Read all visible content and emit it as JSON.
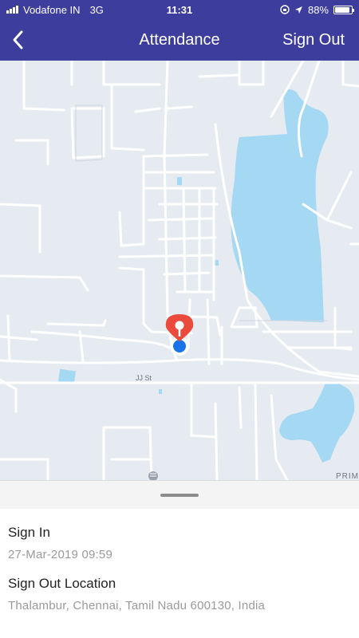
{
  "status_bar": {
    "carrier": "Vodafone IN",
    "network": "3G",
    "time": "11:31",
    "battery_percent": "88%",
    "battery_level": 0.88,
    "icons": [
      "signal-bars-icon",
      "lock-rotation-icon",
      "location-arrow-icon",
      "battery-icon"
    ]
  },
  "nav": {
    "back_icon": "chevron-left-icon",
    "title": "Attendance",
    "action_label": "Sign Out"
  },
  "map": {
    "street_label": "JJ St",
    "corner_label": "PRIM",
    "pin_icon": "red-location-pin-icon",
    "current_location_icon": "blue-dot-icon",
    "colors": {
      "land": "#e6ebf2",
      "roads": "#ffffff",
      "water": "#a5d8f3",
      "pin": "#ea4b3c",
      "user_dot": "#1a73e8"
    }
  },
  "details": {
    "sign_in_label": "Sign In",
    "sign_in_time": "27-Mar-2019 09:59",
    "location_label": "Sign Out Location",
    "location_value": "Thalambur, Chennai, Tamil Nadu 600130, India"
  },
  "colors": {
    "header": "#3d3d9e",
    "header_text": "#ffffff",
    "label": "#222222",
    "muted": "#9a9a9a"
  }
}
